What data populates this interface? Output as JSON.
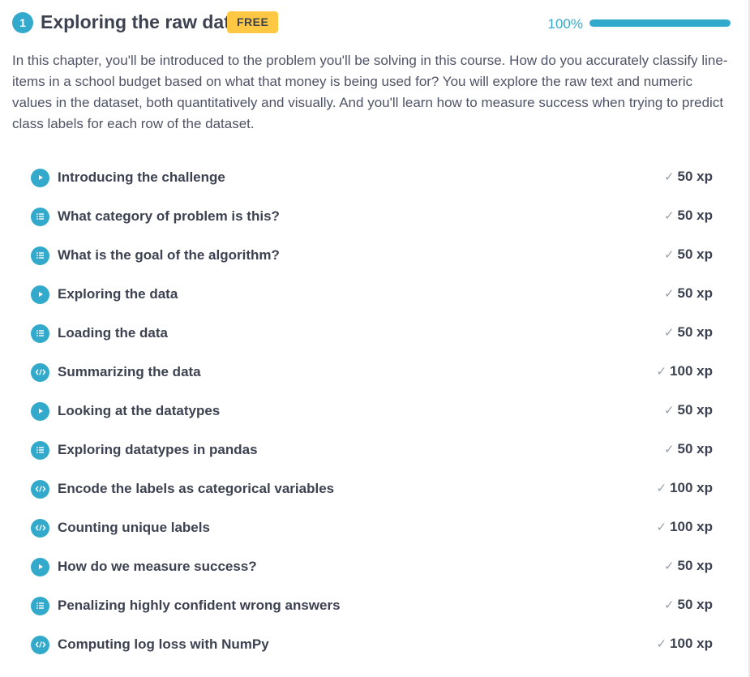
{
  "chapter": {
    "number": "1",
    "title": "Exploring the raw data",
    "badge": "FREE",
    "progress_text": "100%",
    "progress_value": 1.0,
    "description": "In this chapter, you'll be introduced to the problem you'll be solving in this course. How do you accurately classify line-items in a school budget based on what that money is being used for? You will explore the raw text and numeric values in the dataset, both quantitatively and visually. And you'll learn how to measure success when trying to predict class labels for each row of the dataset."
  },
  "exercises": [
    {
      "title": "Introducing the challenge",
      "xp": "50 xp",
      "icon": "play-icon",
      "completed": true
    },
    {
      "title": "What category of problem is this?",
      "xp": "50 xp",
      "icon": "list-icon",
      "completed": true
    },
    {
      "title": "What is the goal of the algorithm?",
      "xp": "50 xp",
      "icon": "list-icon",
      "completed": true
    },
    {
      "title": "Exploring the data",
      "xp": "50 xp",
      "icon": "play-icon",
      "completed": true
    },
    {
      "title": "Loading the data",
      "xp": "50 xp",
      "icon": "list-icon",
      "completed": true
    },
    {
      "title": "Summarizing the data",
      "xp": "100 xp",
      "icon": "code-icon",
      "completed": true
    },
    {
      "title": "Looking at the datatypes",
      "xp": "50 xp",
      "icon": "play-icon",
      "completed": true
    },
    {
      "title": "Exploring datatypes in pandas",
      "xp": "50 xp",
      "icon": "list-icon",
      "completed": true
    },
    {
      "title": "Encode the labels as categorical variables",
      "xp": "100 xp",
      "icon": "code-icon",
      "completed": true
    },
    {
      "title": "Counting unique labels",
      "xp": "100 xp",
      "icon": "code-icon",
      "completed": true
    },
    {
      "title": "How do we measure success?",
      "xp": "50 xp",
      "icon": "play-icon",
      "completed": true
    },
    {
      "title": "Penalizing highly confident wrong answers",
      "xp": "50 xp",
      "icon": "list-icon",
      "completed": true
    },
    {
      "title": "Computing log loss with NumPy",
      "xp": "100 xp",
      "icon": "code-icon",
      "completed": true
    }
  ],
  "symbols": {
    "check": "✓"
  },
  "colors": {
    "accent": "#33aacc",
    "badge": "#ffc844",
    "text": "#3d4251",
    "muted_check": "#9aa0aa"
  }
}
